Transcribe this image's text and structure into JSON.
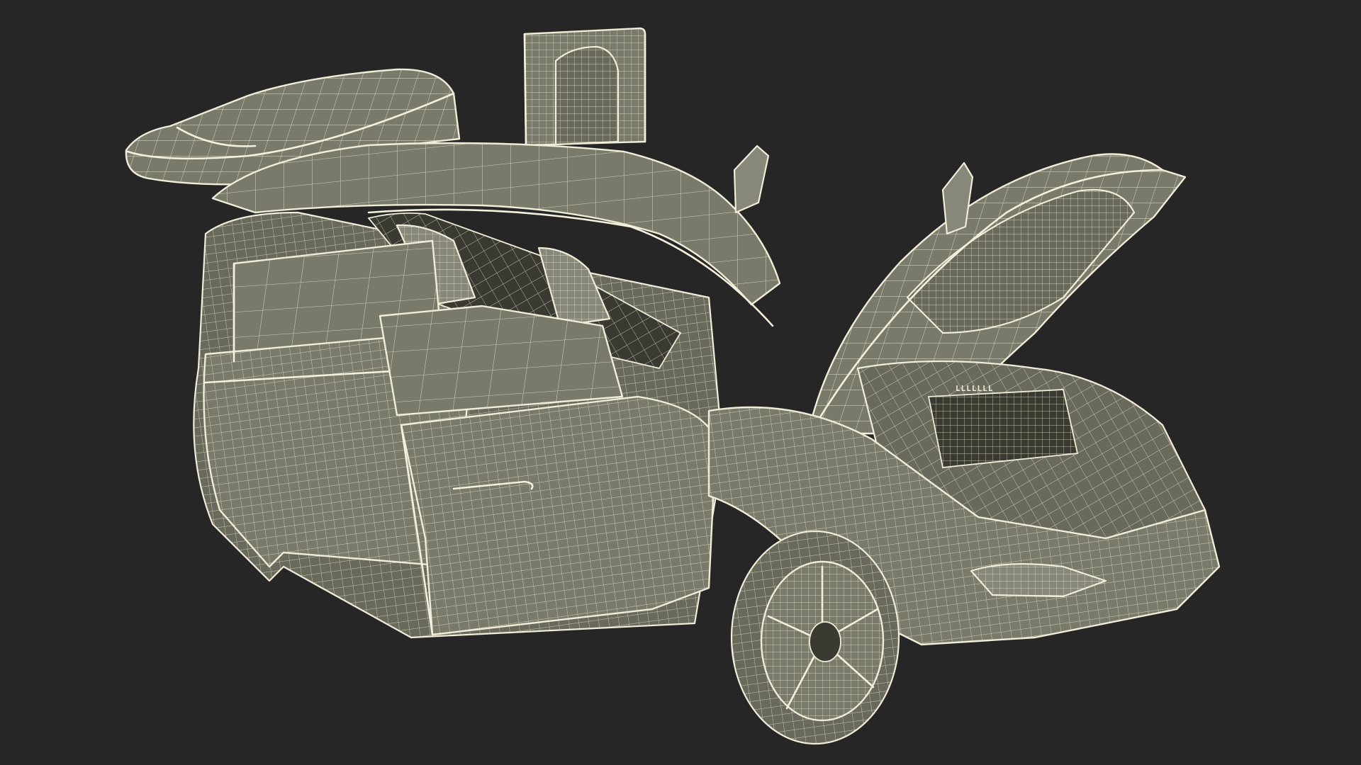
{
  "scene": {
    "background_color": "#262626",
    "mesh_color": "#f0ecd8",
    "surface_color": "#7a7a6a",
    "parts": [
      "charging-station",
      "open-tailgate",
      "roof",
      "rear-door-open",
      "front-door-open",
      "open-hood",
      "front-trunk",
      "front-wheel",
      "headlight",
      "windshield",
      "interior-seats"
    ]
  },
  "labels": {
    "front_trunk_badge": "LLLLLLL"
  }
}
